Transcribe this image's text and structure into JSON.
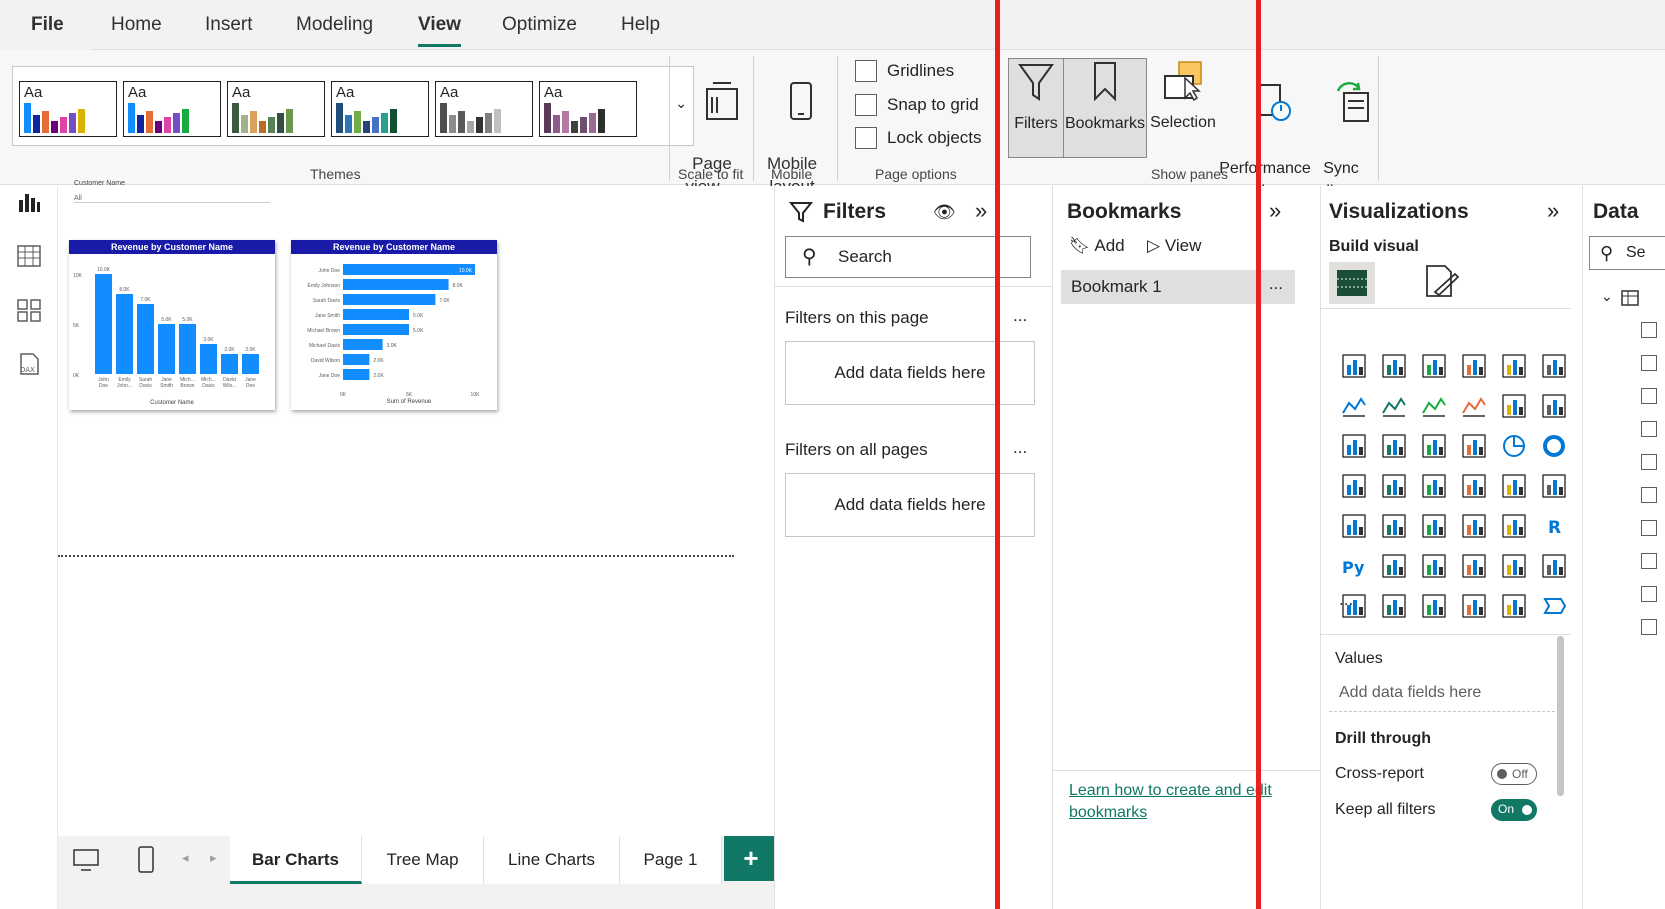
{
  "menu": {
    "tabs": [
      "File",
      "Home",
      "Insert",
      "Modeling",
      "View",
      "Optimize",
      "Help"
    ],
    "active": "View"
  },
  "ribbon": {
    "themes_label": "Themes",
    "theme_tile_label": "Aa",
    "themes": [
      {
        "colors": [
          "#118dff",
          "#12239e",
          "#e66c37",
          "#6b007b",
          "#e044a7",
          "#744ec2",
          "#d9b300"
        ]
      },
      {
        "colors": [
          "#118dff",
          "#12239e",
          "#e66c37",
          "#6b007b",
          "#e044a7",
          "#744ec2",
          "#1aab40"
        ]
      },
      {
        "colors": [
          "#3a5a40",
          "#a3b18a",
          "#dda15e",
          "#bc6c25",
          "#588157",
          "#344e41",
          "#6a994e"
        ]
      },
      {
        "colors": [
          "#1f4e79",
          "#2e75b6",
          "#70ad47",
          "#264478",
          "#4472c4",
          "#2b9e8f",
          "#0f5132"
        ]
      },
      {
        "colors": [
          "#4d4d4d",
          "#8c8c8c",
          "#595959",
          "#a6a6a6",
          "#333333",
          "#7f7f7f",
          "#bfbfbf"
        ]
      },
      {
        "colors": [
          "#5b3a5a",
          "#8e5e8a",
          "#b17aa6",
          "#3f3f3f",
          "#6e4e6e",
          "#9c6b92",
          "#2e2e2e"
        ]
      }
    ],
    "page_view": "Page\nview ⌄",
    "scale_label": "Scale to fit",
    "mobile_layout": "Mobile\nlayout",
    "mobile_label": "Mobile",
    "gridlines": "Gridlines",
    "snap": "Snap to grid",
    "lock": "Lock objects",
    "page_options_label": "Page options",
    "filters_btn": "Filters",
    "bookmarks_btn": "Bookmarks",
    "selection_btn": "Selection",
    "performance_btn": "Performance\nanalyzer",
    "sync_btn": "Sync\nslicers",
    "show_panes_label": "Show panes"
  },
  "canvas": {
    "slicer_label": "Customer Name",
    "slicer_value": "All",
    "chart_data": [
      {
        "type": "bar",
        "title": "Revenue by Customer Name",
        "xlabel": "Customer Name",
        "ylabel": "",
        "categories": [
          "John Doe",
          "Emily John...",
          "Sarah Davis",
          "Jane Smith",
          "Mich... Brown",
          "Mich... Davis",
          "David Wils...",
          "Jane Doe"
        ],
        "values": [
          10000,
          8000,
          7000,
          5000,
          5000,
          3000,
          2000,
          2000
        ],
        "data_labels": [
          "10.0K",
          "8.0K",
          "7.0K",
          "5.0K",
          "5.0K",
          "3.0K",
          "2.0K",
          "2.0K"
        ],
        "y_ticks": [
          "10K",
          "5K",
          "0K"
        ],
        "ylim": [
          0,
          10000
        ],
        "color": "#118dff"
      },
      {
        "type": "bar",
        "orientation": "horizontal",
        "title": "Revenue by Customer Name",
        "xlabel": "Sum of Revenue",
        "ylabel": "",
        "categories": [
          "John Doe",
          "Emily Johnson",
          "Sarah Davis",
          "Jane Smith",
          "Michael Brown",
          "Michael Davis",
          "David Wilson",
          "Jane Doe"
        ],
        "values": [
          10000,
          8000,
          7000,
          5000,
          5000,
          3000,
          2000,
          2000
        ],
        "data_labels": [
          "10.0K",
          "8.0K",
          "7.0K",
          "5.0K",
          "5.0K",
          "3.0K",
          "2.0K",
          "2.0K"
        ],
        "x_ticks": [
          "0K",
          "5K",
          "10K"
        ],
        "xlim": [
          0,
          10000
        ],
        "color": "#118dff"
      }
    ]
  },
  "pages": {
    "tabs": [
      "Bar Charts",
      "Tree Map",
      "Line Charts",
      "Page 1"
    ],
    "active": "Bar Charts",
    "add": "+"
  },
  "filters": {
    "title": "Filters",
    "search_placeholder": "Search",
    "on_page": "Filters on this page",
    "on_all": "Filters on all pages",
    "add_fields": "Add data fields here",
    "more": "..."
  },
  "bookmarks": {
    "title": "Bookmarks",
    "add": "Add",
    "view": "View",
    "items": [
      "Bookmark 1"
    ],
    "more": "...",
    "learn_link": "Learn how to create and edit bookmarks"
  },
  "viz": {
    "title": "Visualizations",
    "build": "Build visual",
    "values": "Values",
    "add_fields": "Add data fields here",
    "drill": "Drill through",
    "cross_report": "Cross-report",
    "cross_state": "Off",
    "keep_filters": "Keep all filters",
    "keep_state": "On",
    "more": "..."
  },
  "data": {
    "title": "Data",
    "search_placeholder": "Se"
  },
  "colors": {
    "accent": "#117865",
    "highlight": "#e8211e",
    "bar": "#118dff",
    "title_bar": "#1a1aa8"
  }
}
